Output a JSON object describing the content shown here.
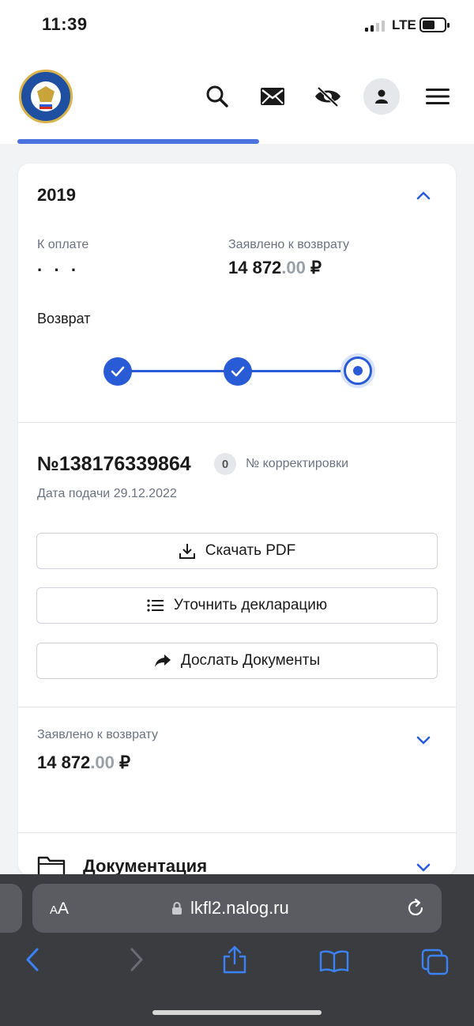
{
  "status_bar": {
    "time": "11:39",
    "network": "LTE"
  },
  "header": {
    "icons": [
      "search-icon",
      "mail-icon",
      "eye-off-icon",
      "user-icon",
      "menu-icon"
    ],
    "accent_color": "#2a5bd7"
  },
  "declaration": {
    "year": "2019",
    "to_pay_label": "К оплате",
    "to_pay_value": "· · ·",
    "claimed_label": "Заявлено к возврату",
    "claimed_whole": "14 872",
    "claimed_cents": ".00",
    "currency": "₽",
    "refund_label": "Возврат",
    "steps": [
      {
        "state": "done"
      },
      {
        "state": "done"
      },
      {
        "state": "current"
      }
    ],
    "number": "№138176339864",
    "correction_count": "0",
    "correction_label": "№ корректировки",
    "date_label": "Дата подачи 29.12.2022"
  },
  "actions": {
    "download_pdf": "Скачать PDF",
    "refine_declaration": "Уточнить декларацию",
    "send_documents": "Дослать Документы"
  },
  "claimed_section": {
    "label": "Заявлено к возврату",
    "whole": "14 872",
    "cents": ".00",
    "currency": "₽"
  },
  "documentation": {
    "title": "Документация"
  },
  "browser": {
    "aa_label_small": "A",
    "aa_label_large": "A",
    "url": "lkfl2.nalog.ru"
  }
}
